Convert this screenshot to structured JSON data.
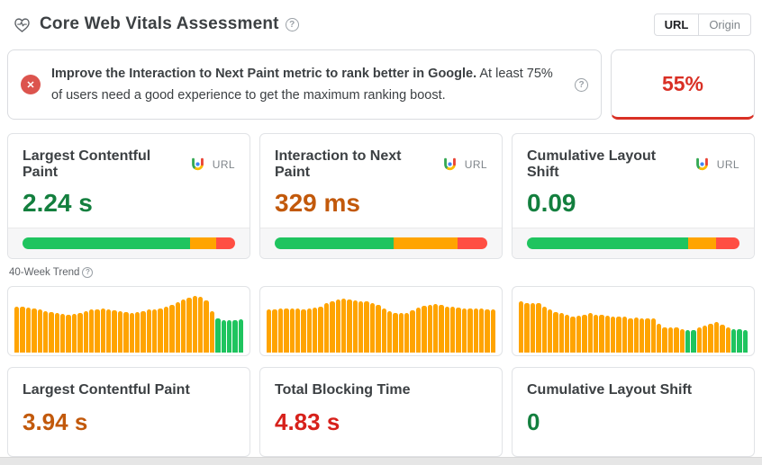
{
  "colors": {
    "bar_good": "#1fc45f",
    "bar_needs_improvement": "#ffa400",
    "bar_poor": "#ff4e43",
    "text_good": "#137f3e",
    "text_needs_improvement": "#c2590b",
    "text_poor": "#d7211b",
    "accent_red": "#d93025"
  },
  "header": {
    "title": "Core Web Vitals Assessment",
    "toggle": {
      "options": [
        "URL",
        "Origin"
      ],
      "selected": "URL"
    }
  },
  "alert": {
    "bold_text": "Improve the Interaction to Next Paint metric to rank better in Google.",
    "normal_text": "At least 75% of users need a good experience to get the maximum ranking boost.",
    "icon": "x-circle",
    "score_value": "55%"
  },
  "metric_cards": [
    {
      "title": "Largest Contentful Paint",
      "source_icon": "chrome-ux",
      "scope_label": "URL",
      "value": "2.24 s",
      "value_color": "#137f3e",
      "distribution": {
        "good": 79,
        "needs_improvement": 12,
        "poor": 9
      }
    },
    {
      "title": "Interaction to Next Paint",
      "source_icon": "chrome-ux",
      "scope_label": "URL",
      "value": "329 ms",
      "value_color": "#c2590b",
      "distribution": {
        "good": 56,
        "needs_improvement": 30,
        "poor": 14
      }
    },
    {
      "title": "Cumulative Layout Shift",
      "source_icon": "chrome-ux",
      "scope_label": "URL",
      "value": "0.09",
      "value_color": "#137f3e",
      "distribution": {
        "good": 76,
        "needs_improvement": 13,
        "poor": 11
      }
    }
  ],
  "trend_label": "40-Week Trend",
  "chart_data": [
    {
      "type": "bar",
      "title": "Largest Contentful Paint 40-week trend",
      "values": [
        78,
        77,
        76,
        74,
        72,
        70,
        68,
        66,
        65,
        64,
        65,
        67,
        70,
        72,
        73,
        74,
        73,
        71,
        69,
        68,
        67,
        68,
        70,
        72,
        73,
        74,
        77,
        81,
        85,
        89,
        93,
        96,
        94,
        88,
        70,
        57,
        55,
        54,
        55,
        56
      ],
      "green_indices": [
        35,
        36,
        37,
        38,
        39
      ],
      "ylim": [
        0,
        100
      ],
      "legend": "off",
      "grid": "off"
    },
    {
      "type": "bar",
      "title": "Total Blocking Time 40-week trend",
      "values": [
        72,
        73,
        74,
        75,
        75,
        74,
        73,
        74,
        76,
        78,
        84,
        87,
        89,
        91,
        90,
        88,
        87,
        86,
        84,
        80,
        75,
        70,
        67,
        66,
        67,
        71,
        76,
        79,
        81,
        82,
        80,
        78,
        77,
        76,
        75,
        75,
        74,
        74,
        73,
        72
      ],
      "green_indices": [],
      "ylim": [
        0,
        100
      ],
      "legend": "off",
      "grid": "off"
    },
    {
      "type": "bar",
      "title": "Cumulative Layout Shift 40-week trend",
      "values": [
        86,
        84,
        84,
        83,
        78,
        72,
        68,
        66,
        63,
        60,
        62,
        64,
        66,
        64,
        63,
        62,
        61,
        60,
        61,
        58,
        59,
        58,
        58,
        57,
        48,
        43,
        43,
        42,
        40,
        38,
        38,
        43,
        46,
        49,
        51,
        47,
        43,
        40,
        39,
        38
      ],
      "green_indices": [
        29,
        30,
        37,
        38,
        39
      ],
      "ylim": [
        0,
        100
      ],
      "legend": "off",
      "grid": "off"
    }
  ],
  "summary_cards": [
    {
      "title": "Largest Contentful Paint",
      "value": "3.94 s",
      "value_color": "#c2590b"
    },
    {
      "title": "Total Blocking Time",
      "value": "4.83 s",
      "value_color": "#d7211b"
    },
    {
      "title": "Cumulative Layout Shift",
      "value": "0",
      "value_color": "#137f3e"
    }
  ]
}
